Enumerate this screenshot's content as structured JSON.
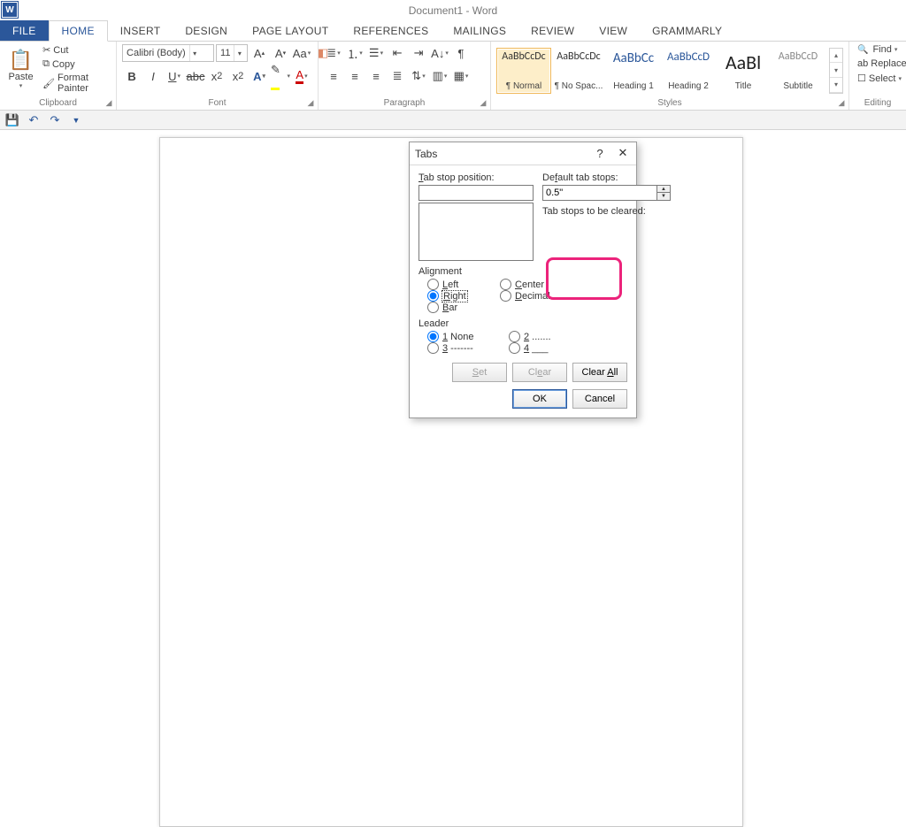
{
  "app": {
    "title": "Document1 - Word",
    "icon_letter": "W"
  },
  "tabs": {
    "file": "FILE",
    "home": "HOME",
    "insert": "INSERT",
    "design": "DESIGN",
    "pagelayout": "PAGE LAYOUT",
    "references": "REFERENCES",
    "mailings": "MAILINGS",
    "review": "REVIEW",
    "view": "VIEW",
    "grammarly": "GRAMMARLY"
  },
  "clipboard": {
    "paste": "Paste",
    "cut": "Cut",
    "copy": "Copy",
    "format_painter": "Format Painter",
    "label": "Clipboard"
  },
  "font": {
    "name": "Calibri (Body)",
    "size": "11",
    "label": "Font"
  },
  "paragraph": {
    "label": "Paragraph"
  },
  "styles": {
    "label": "Styles",
    "items": [
      {
        "preview": "AaBbCcDc",
        "name": "¶ Normal",
        "size": "12",
        "color": "#333"
      },
      {
        "preview": "AaBbCcDc",
        "name": "¶ No Spac...",
        "size": "12",
        "color": "#333"
      },
      {
        "preview": "AaBbCc",
        "name": "Heading 1",
        "size": "15",
        "color": "#2b579a"
      },
      {
        "preview": "AaBbCcD",
        "name": "Heading 2",
        "size": "13",
        "color": "#2b579a"
      },
      {
        "preview": "AaBl",
        "name": "Title",
        "size": "22",
        "color": "#222"
      },
      {
        "preview": "AaBbCcD",
        "name": "Subtitle",
        "size": "12",
        "color": "#888"
      }
    ]
  },
  "editing": {
    "label": "Editing",
    "find": "Find",
    "replace": "Replace",
    "select": "Select"
  },
  "dialog": {
    "title": "Tabs",
    "tab_stop_position_label": "Tab stop position:",
    "default_label": "Default tab stops:",
    "default_value": "0.5\"",
    "to_clear_label": "Tab stops to be cleared:",
    "alignment_label": "Alignment",
    "align": {
      "left": "Left",
      "center": "Center",
      "right": "Right",
      "decimal": "Decimal",
      "bar": "Bar"
    },
    "leader_label": "Leader",
    "leader": {
      "none": "1 None",
      "dots": "2 .......",
      "dashes": "3 -------",
      "under": "4 ___"
    },
    "buttons": {
      "set": "Set",
      "clear": "Clear",
      "clear_all": "Clear All",
      "ok": "OK",
      "cancel": "Cancel"
    }
  }
}
